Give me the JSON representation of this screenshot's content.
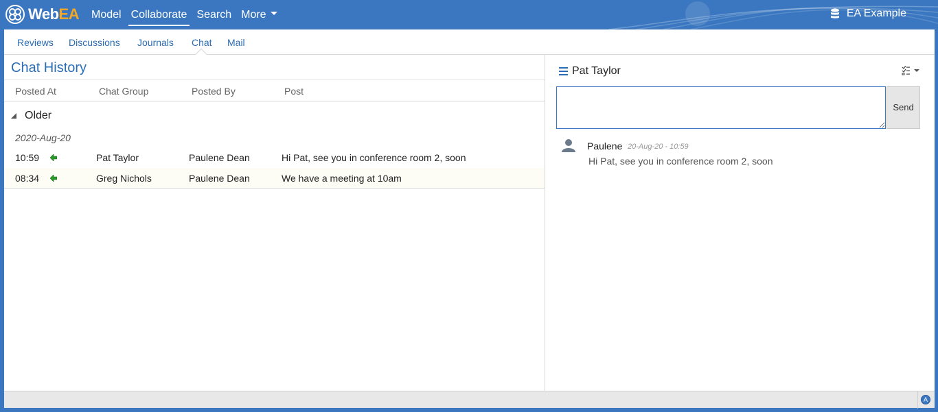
{
  "brand": {
    "name_part1": "Web",
    "name_part2": "EA"
  },
  "topnav": {
    "items": [
      "Model",
      "Collaborate",
      "Search",
      "More"
    ],
    "active": "Collaborate"
  },
  "model_name": "EA Example",
  "subnav": {
    "items": [
      "Reviews",
      "Discussions",
      "Journals",
      "Chat",
      "Mail"
    ],
    "active": "Chat"
  },
  "chat_history": {
    "title": "Chat History",
    "columns": [
      "Posted At",
      "Chat Group",
      "Posted By",
      "Post"
    ],
    "group_label": "Older",
    "date_label": "2020-Aug-20",
    "rows": [
      {
        "time": "10:59",
        "group": "Pat Taylor",
        "posted_by": "Paulene Dean",
        "post": "Hi Pat, see you in conference room 2, soon"
      },
      {
        "time": "08:34",
        "group": "Greg Nichols",
        "posted_by": "Paulene Dean",
        "post": "We have a meeting at 10am"
      }
    ]
  },
  "chat_panel": {
    "title": "Pat Taylor",
    "input_value": "",
    "send_label": "Send",
    "messages": [
      {
        "author": "Paulene",
        "timestamp": "20-Aug-20 - 10:59",
        "text": "Hi Pat, see you in conference room 2, soon"
      }
    ]
  },
  "colors": {
    "accent": "#3a77c0",
    "link": "#2a6db5",
    "brand_orange": "#f5a623",
    "arrow_green": "#2a9a2a"
  },
  "icons": [
    "webea-logo-icon",
    "database-icon",
    "list-icon",
    "checklist-icon",
    "user-icon",
    "arrow-left-icon",
    "status-a-icon"
  ]
}
